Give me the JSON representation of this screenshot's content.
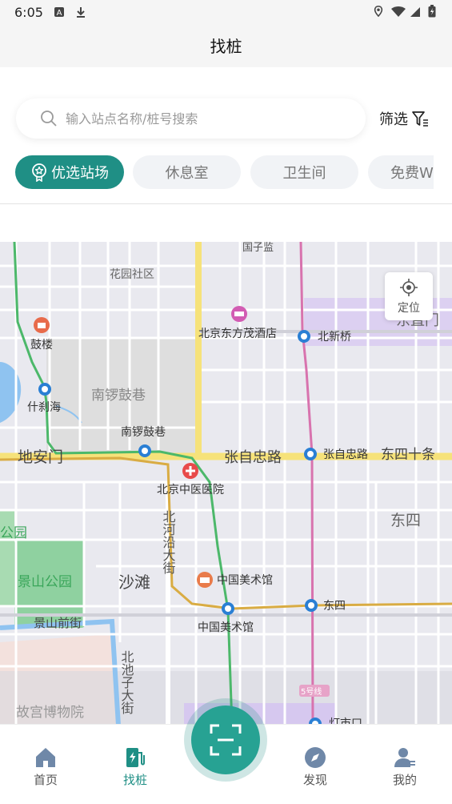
{
  "status": {
    "time": "6:05"
  },
  "header": {
    "title": "找桩"
  },
  "search": {
    "placeholder": "输入站点名称/桩号搜索",
    "filter_label": "筛选"
  },
  "tags": [
    {
      "label": "优选站场",
      "active": true
    },
    {
      "label": "休息室"
    },
    {
      "label": "卫生间"
    },
    {
      "label": "免费WiFi"
    }
  ],
  "map": {
    "locate_label": "定位",
    "labels": {
      "guozijian": "国子监",
      "huayuan": "花园社区",
      "hotel": "北京东方茂酒店",
      "beixinqiao": "北新桥",
      "dongzhimen": "东直门",
      "gulou": "鼓楼",
      "nanluo_area": "南锣鼓巷",
      "shichahai": "什刹海",
      "nanluo_station": "南锣鼓巷",
      "dianmen": "地安门",
      "zhangzizhong_road": "张自忠路",
      "zhangzizhong_station": "张自忠路",
      "dongsi_shitiao": "东四十条",
      "hospital": "北京中医医院",
      "beiheyan": "北河沿大街",
      "dongsi_area": "东四",
      "gongyuan": "公园",
      "jingshan_park": "景山公园",
      "shatan": "沙滩",
      "art_museum_poi": "中国美术馆",
      "dongsi_station": "东四",
      "jingshan_qianjie": "景山前街",
      "art_museum_station": "中国美术馆",
      "beichizi": "北池子大街",
      "line5": "5号线",
      "gugong": "故宫博物院",
      "dengshikou": "灯市口"
    }
  },
  "tabbar": {
    "items": [
      {
        "label": "首页"
      },
      {
        "label": "找桩",
        "active": true
      },
      {
        "label": "发现"
      },
      {
        "label": "我的"
      }
    ]
  },
  "colors": {
    "accent": "#1f8f85",
    "metro_green": "#4cb86a",
    "metro_pink": "#d873ae",
    "metro_gold": "#d9ac43",
    "road_yellow": "#f6e27a"
  }
}
